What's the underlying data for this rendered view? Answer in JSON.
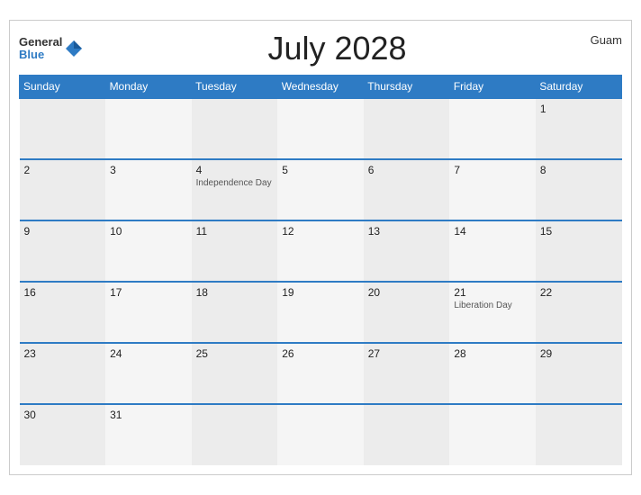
{
  "header": {
    "brand_general": "General",
    "brand_blue": "Blue",
    "title": "July 2028",
    "region": "Guam"
  },
  "weekdays": [
    "Sunday",
    "Monday",
    "Tuesday",
    "Wednesday",
    "Thursday",
    "Friday",
    "Saturday"
  ],
  "weeks": [
    [
      {
        "day": "",
        "event": ""
      },
      {
        "day": "",
        "event": ""
      },
      {
        "day": "",
        "event": ""
      },
      {
        "day": "",
        "event": ""
      },
      {
        "day": "",
        "event": ""
      },
      {
        "day": "",
        "event": ""
      },
      {
        "day": "1",
        "event": ""
      }
    ],
    [
      {
        "day": "2",
        "event": ""
      },
      {
        "day": "3",
        "event": ""
      },
      {
        "day": "4",
        "event": "Independence Day"
      },
      {
        "day": "5",
        "event": ""
      },
      {
        "day": "6",
        "event": ""
      },
      {
        "day": "7",
        "event": ""
      },
      {
        "day": "8",
        "event": ""
      }
    ],
    [
      {
        "day": "9",
        "event": ""
      },
      {
        "day": "10",
        "event": ""
      },
      {
        "day": "11",
        "event": ""
      },
      {
        "day": "12",
        "event": ""
      },
      {
        "day": "13",
        "event": ""
      },
      {
        "day": "14",
        "event": ""
      },
      {
        "day": "15",
        "event": ""
      }
    ],
    [
      {
        "day": "16",
        "event": ""
      },
      {
        "day": "17",
        "event": ""
      },
      {
        "day": "18",
        "event": ""
      },
      {
        "day": "19",
        "event": ""
      },
      {
        "day": "20",
        "event": ""
      },
      {
        "day": "21",
        "event": "Liberation Day"
      },
      {
        "day": "22",
        "event": ""
      }
    ],
    [
      {
        "day": "23",
        "event": ""
      },
      {
        "day": "24",
        "event": ""
      },
      {
        "day": "25",
        "event": ""
      },
      {
        "day": "26",
        "event": ""
      },
      {
        "day": "27",
        "event": ""
      },
      {
        "day": "28",
        "event": ""
      },
      {
        "day": "29",
        "event": ""
      }
    ],
    [
      {
        "day": "30",
        "event": ""
      },
      {
        "day": "31",
        "event": ""
      },
      {
        "day": "",
        "event": ""
      },
      {
        "day": "",
        "event": ""
      },
      {
        "day": "",
        "event": ""
      },
      {
        "day": "",
        "event": ""
      },
      {
        "day": "",
        "event": ""
      }
    ]
  ]
}
